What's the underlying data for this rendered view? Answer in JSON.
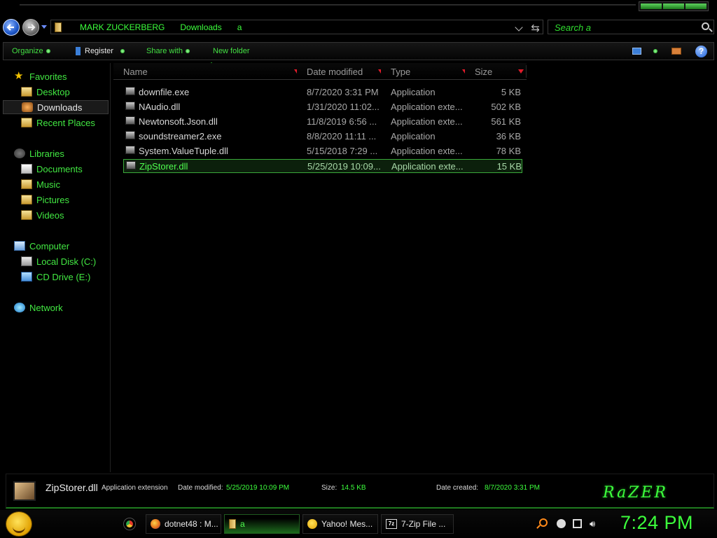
{
  "address_bar": {
    "crumbs": [
      "MARK ZUCKERBERG",
      "Downloads",
      "a"
    ]
  },
  "search": {
    "placeholder": "Search a"
  },
  "toolbar": {
    "organize": "Organize",
    "register": "Register",
    "share_with": "Share with",
    "new_folder": "New folder",
    "help": "?"
  },
  "nav": {
    "favorites": "Favorites",
    "desktop": "Desktop",
    "downloads": "Downloads",
    "recent_places": "Recent Places",
    "libraries": "Libraries",
    "documents": "Documents",
    "music": "Music",
    "pictures": "Pictures",
    "videos": "Videos",
    "computer": "Computer",
    "local_disk": "Local Disk (C:)",
    "cd_drive": "CD Drive (E:)",
    "network": "Network"
  },
  "columns": {
    "name": "Name",
    "date_modified": "Date modified",
    "type": "Type",
    "size": "Size"
  },
  "files": [
    {
      "name": "downfile.exe",
      "date": "8/7/2020 3:31 PM",
      "type": "Application",
      "size": "5 KB"
    },
    {
      "name": "NAudio.dll",
      "date": "1/31/2020 11:02...",
      "type": "Application exte...",
      "size": "502 KB"
    },
    {
      "name": "Newtonsoft.Json.dll",
      "date": "11/8/2019 6:56 ...",
      "type": "Application exte...",
      "size": "561 KB"
    },
    {
      "name": "soundstreamer2.exe",
      "date": "8/8/2020 11:11 ...",
      "type": "Application",
      "size": "36 KB"
    },
    {
      "name": "System.ValueTuple.dll",
      "date": "5/15/2018 7:29 ...",
      "type": "Application exte...",
      "size": "78 KB"
    },
    {
      "name": "ZipStorer.dll",
      "date": "5/25/2019 10:09...",
      "type": "Application exte...",
      "size": "15 KB"
    }
  ],
  "details": {
    "name": "ZipStorer.dll",
    "type": "Application extension",
    "date_modified_label": "Date modified:",
    "date_modified_value": "5/25/2019 10:09 PM",
    "size_label": "Size:",
    "size_value": "14.5 KB",
    "date_created_label": "Date created:",
    "date_created_value": "8/7/2020 3:31 PM",
    "logo_text": "RaZER"
  },
  "taskbar": {
    "tasks": [
      "dotnet48 : M...",
      "a",
      "Yahoo! Mes...",
      "7-Zip File ..."
    ],
    "sevenzip_icon": "7z",
    "clock": "7:24 PM"
  },
  "colors": {
    "accent_green": "#3cff3c",
    "header_sort_red": "#e01b2a",
    "background": "#000000"
  }
}
